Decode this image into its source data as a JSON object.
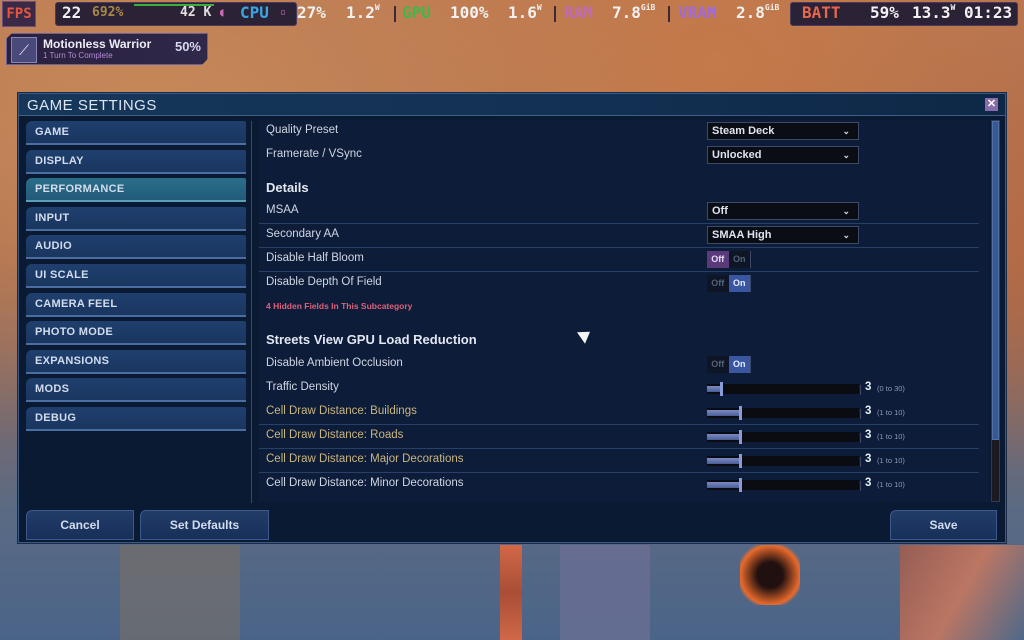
{
  "overlay": {
    "fps_label": "FPS",
    "fps_value": "22",
    "fps_pct": "692%",
    "frame_graph_value": "42 K",
    "cpu_label": "CPU",
    "cpu_usage": "27%",
    "cpu_power": "1.2",
    "cpu_power_unit": "W",
    "gpu_label": "GPU",
    "gpu_usage": "100%",
    "gpu_power": "1.6",
    "gpu_power_unit": "W",
    "ram_label": "RAM",
    "ram_value": "7.8",
    "ram_unit": "GiB",
    "vram_label": "VRAM",
    "vram_value": "2.8",
    "vram_unit": "GiB",
    "batt_label": "BATT",
    "batt_pct": "59%",
    "batt_power": "13.3",
    "batt_power_unit": "W",
    "batt_time": "01:23",
    "colors": {
      "fps": "#e8553c",
      "cpu": "#3aa6e0",
      "gpu": "#3fb84a",
      "ram": "#c06ab8",
      "vram": "#a06ad8",
      "batt": "#e8664a"
    }
  },
  "achievement": {
    "name": "Motionless Warrior",
    "subtitle": "1 Turn To Complete",
    "progress": "50%",
    "icon": "sword-icon"
  },
  "window": {
    "title": "GAME SETTINGS",
    "close_icon": "close-icon"
  },
  "sidebar": {
    "items": [
      {
        "label": "GAME",
        "active": false
      },
      {
        "label": "DISPLAY",
        "active": false
      },
      {
        "label": "PERFORMANCE",
        "active": true
      },
      {
        "label": "INPUT",
        "active": false
      },
      {
        "label": "AUDIO",
        "active": false
      },
      {
        "label": "UI SCALE",
        "active": false
      },
      {
        "label": "CAMERA FEEL",
        "active": false
      },
      {
        "label": "PHOTO MODE",
        "active": false
      },
      {
        "label": "EXPANSIONS",
        "active": false
      },
      {
        "label": "MODS",
        "active": false
      },
      {
        "label": "DEBUG",
        "active": false
      }
    ]
  },
  "settings": {
    "quality_preset": {
      "label": "Quality Preset",
      "value": "Steam Deck"
    },
    "framerate": {
      "label": "Framerate / VSync",
      "value": "Unlocked"
    },
    "details_header": "Details",
    "msaa": {
      "label": "MSAA",
      "value": "Off"
    },
    "secondary_aa": {
      "label": "Secondary AA",
      "value": "SMAA High"
    },
    "half_bloom": {
      "label": "Disable Half Bloom",
      "off": "Off",
      "on": "On",
      "state": "Off"
    },
    "depth_of_field": {
      "label": "Disable Depth Of Field",
      "off": "Off",
      "on": "On",
      "state": "On"
    },
    "hidden_note": "4 Hidden Fields In This Subcategory",
    "streets_header": "Streets View GPU Load Reduction",
    "ambient_occlusion": {
      "label": "Disable Ambient Occlusion",
      "off": "Off",
      "on": "On",
      "state": "On"
    },
    "sliders": [
      {
        "label": "Traffic Density",
        "value": "3",
        "range": "(0 to 30)",
        "min": 0,
        "max": 30,
        "num": 3,
        "gold": false
      },
      {
        "label": "Cell Draw Distance: Buildings",
        "value": "3",
        "range": "(1 to 10)",
        "min": 1,
        "max": 10,
        "num": 3,
        "gold": true
      },
      {
        "label": "Cell Draw Distance: Roads",
        "value": "3",
        "range": "(1 to 10)",
        "min": 1,
        "max": 10,
        "num": 3,
        "gold": true
      },
      {
        "label": "Cell Draw Distance: Major Decorations",
        "value": "3",
        "range": "(1 to 10)",
        "min": 1,
        "max": 10,
        "num": 3,
        "gold": true
      },
      {
        "label": "Cell Draw Distance: Minor Decorations",
        "value": "3",
        "range": "(1 to 10)",
        "min": 1,
        "max": 10,
        "num": 3,
        "gold": false
      }
    ],
    "scroll_fraction": 0.84
  },
  "footer": {
    "cancel": "Cancel",
    "set_defaults": "Set Defaults",
    "save": "Save"
  }
}
